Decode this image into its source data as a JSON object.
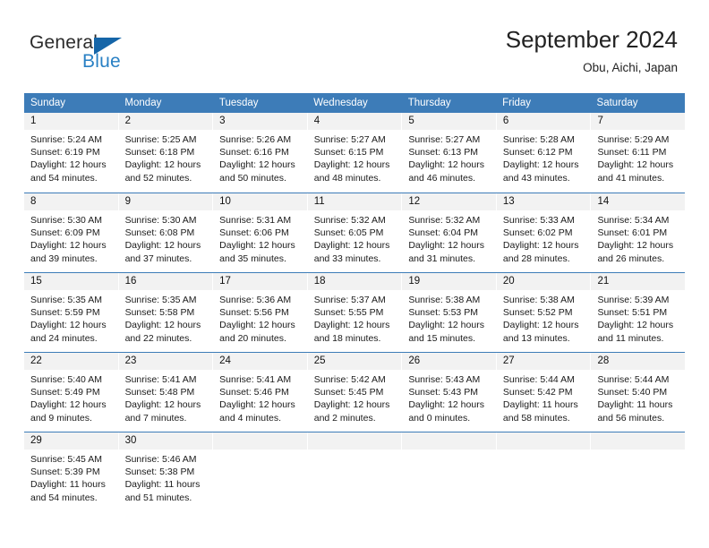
{
  "brand": {
    "general": "General",
    "blue": "Blue",
    "triangle_icon": "brand-triangle-icon"
  },
  "header": {
    "title": "September 2024",
    "subtitle": "Obu, Aichi, Japan"
  },
  "theme": {
    "accent": "#3d7cb8",
    "brand_blue": "#2980c4",
    "brand_dark": "#2b2b2b",
    "daynum_bg": "#f2f2f2",
    "text": "#1a1a1a"
  },
  "weekdays": [
    "Sunday",
    "Monday",
    "Tuesday",
    "Wednesday",
    "Thursday",
    "Friday",
    "Saturday"
  ],
  "weeks": [
    [
      {
        "day": "1",
        "sunrise": "Sunrise: 5:24 AM",
        "sunset": "Sunset: 6:19 PM",
        "daylight1": "Daylight: 12 hours",
        "daylight2": "and 54 minutes."
      },
      {
        "day": "2",
        "sunrise": "Sunrise: 5:25 AM",
        "sunset": "Sunset: 6:18 PM",
        "daylight1": "Daylight: 12 hours",
        "daylight2": "and 52 minutes."
      },
      {
        "day": "3",
        "sunrise": "Sunrise: 5:26 AM",
        "sunset": "Sunset: 6:16 PM",
        "daylight1": "Daylight: 12 hours",
        "daylight2": "and 50 minutes."
      },
      {
        "day": "4",
        "sunrise": "Sunrise: 5:27 AM",
        "sunset": "Sunset: 6:15 PM",
        "daylight1": "Daylight: 12 hours",
        "daylight2": "and 48 minutes."
      },
      {
        "day": "5",
        "sunrise": "Sunrise: 5:27 AM",
        "sunset": "Sunset: 6:13 PM",
        "daylight1": "Daylight: 12 hours",
        "daylight2": "and 46 minutes."
      },
      {
        "day": "6",
        "sunrise": "Sunrise: 5:28 AM",
        "sunset": "Sunset: 6:12 PM",
        "daylight1": "Daylight: 12 hours",
        "daylight2": "and 43 minutes."
      },
      {
        "day": "7",
        "sunrise": "Sunrise: 5:29 AM",
        "sunset": "Sunset: 6:11 PM",
        "daylight1": "Daylight: 12 hours",
        "daylight2": "and 41 minutes."
      }
    ],
    [
      {
        "day": "8",
        "sunrise": "Sunrise: 5:30 AM",
        "sunset": "Sunset: 6:09 PM",
        "daylight1": "Daylight: 12 hours",
        "daylight2": "and 39 minutes."
      },
      {
        "day": "9",
        "sunrise": "Sunrise: 5:30 AM",
        "sunset": "Sunset: 6:08 PM",
        "daylight1": "Daylight: 12 hours",
        "daylight2": "and 37 minutes."
      },
      {
        "day": "10",
        "sunrise": "Sunrise: 5:31 AM",
        "sunset": "Sunset: 6:06 PM",
        "daylight1": "Daylight: 12 hours",
        "daylight2": "and 35 minutes."
      },
      {
        "day": "11",
        "sunrise": "Sunrise: 5:32 AM",
        "sunset": "Sunset: 6:05 PM",
        "daylight1": "Daylight: 12 hours",
        "daylight2": "and 33 minutes."
      },
      {
        "day": "12",
        "sunrise": "Sunrise: 5:32 AM",
        "sunset": "Sunset: 6:04 PM",
        "daylight1": "Daylight: 12 hours",
        "daylight2": "and 31 minutes."
      },
      {
        "day": "13",
        "sunrise": "Sunrise: 5:33 AM",
        "sunset": "Sunset: 6:02 PM",
        "daylight1": "Daylight: 12 hours",
        "daylight2": "and 28 minutes."
      },
      {
        "day": "14",
        "sunrise": "Sunrise: 5:34 AM",
        "sunset": "Sunset: 6:01 PM",
        "daylight1": "Daylight: 12 hours",
        "daylight2": "and 26 minutes."
      }
    ],
    [
      {
        "day": "15",
        "sunrise": "Sunrise: 5:35 AM",
        "sunset": "Sunset: 5:59 PM",
        "daylight1": "Daylight: 12 hours",
        "daylight2": "and 24 minutes."
      },
      {
        "day": "16",
        "sunrise": "Sunrise: 5:35 AM",
        "sunset": "Sunset: 5:58 PM",
        "daylight1": "Daylight: 12 hours",
        "daylight2": "and 22 minutes."
      },
      {
        "day": "17",
        "sunrise": "Sunrise: 5:36 AM",
        "sunset": "Sunset: 5:56 PM",
        "daylight1": "Daylight: 12 hours",
        "daylight2": "and 20 minutes."
      },
      {
        "day": "18",
        "sunrise": "Sunrise: 5:37 AM",
        "sunset": "Sunset: 5:55 PM",
        "daylight1": "Daylight: 12 hours",
        "daylight2": "and 18 minutes."
      },
      {
        "day": "19",
        "sunrise": "Sunrise: 5:38 AM",
        "sunset": "Sunset: 5:53 PM",
        "daylight1": "Daylight: 12 hours",
        "daylight2": "and 15 minutes."
      },
      {
        "day": "20",
        "sunrise": "Sunrise: 5:38 AM",
        "sunset": "Sunset: 5:52 PM",
        "daylight1": "Daylight: 12 hours",
        "daylight2": "and 13 minutes."
      },
      {
        "day": "21",
        "sunrise": "Sunrise: 5:39 AM",
        "sunset": "Sunset: 5:51 PM",
        "daylight1": "Daylight: 12 hours",
        "daylight2": "and 11 minutes."
      }
    ],
    [
      {
        "day": "22",
        "sunrise": "Sunrise: 5:40 AM",
        "sunset": "Sunset: 5:49 PM",
        "daylight1": "Daylight: 12 hours",
        "daylight2": "and 9 minutes."
      },
      {
        "day": "23",
        "sunrise": "Sunrise: 5:41 AM",
        "sunset": "Sunset: 5:48 PM",
        "daylight1": "Daylight: 12 hours",
        "daylight2": "and 7 minutes."
      },
      {
        "day": "24",
        "sunrise": "Sunrise: 5:41 AM",
        "sunset": "Sunset: 5:46 PM",
        "daylight1": "Daylight: 12 hours",
        "daylight2": "and 4 minutes."
      },
      {
        "day": "25",
        "sunrise": "Sunrise: 5:42 AM",
        "sunset": "Sunset: 5:45 PM",
        "daylight1": "Daylight: 12 hours",
        "daylight2": "and 2 minutes."
      },
      {
        "day": "26",
        "sunrise": "Sunrise: 5:43 AM",
        "sunset": "Sunset: 5:43 PM",
        "daylight1": "Daylight: 12 hours",
        "daylight2": "and 0 minutes."
      },
      {
        "day": "27",
        "sunrise": "Sunrise: 5:44 AM",
        "sunset": "Sunset: 5:42 PM",
        "daylight1": "Daylight: 11 hours",
        "daylight2": "and 58 minutes."
      },
      {
        "day": "28",
        "sunrise": "Sunrise: 5:44 AM",
        "sunset": "Sunset: 5:40 PM",
        "daylight1": "Daylight: 11 hours",
        "daylight2": "and 56 minutes."
      }
    ],
    [
      {
        "day": "29",
        "sunrise": "Sunrise: 5:45 AM",
        "sunset": "Sunset: 5:39 PM",
        "daylight1": "Daylight: 11 hours",
        "daylight2": "and 54 minutes."
      },
      {
        "day": "30",
        "sunrise": "Sunrise: 5:46 AM",
        "sunset": "Sunset: 5:38 PM",
        "daylight1": "Daylight: 11 hours",
        "daylight2": "and 51 minutes."
      },
      {
        "day": "",
        "sunrise": "",
        "sunset": "",
        "daylight1": "",
        "daylight2": ""
      },
      {
        "day": "",
        "sunrise": "",
        "sunset": "",
        "daylight1": "",
        "daylight2": ""
      },
      {
        "day": "",
        "sunrise": "",
        "sunset": "",
        "daylight1": "",
        "daylight2": ""
      },
      {
        "day": "",
        "sunrise": "",
        "sunset": "",
        "daylight1": "",
        "daylight2": ""
      },
      {
        "day": "",
        "sunrise": "",
        "sunset": "",
        "daylight1": "",
        "daylight2": ""
      }
    ]
  ]
}
